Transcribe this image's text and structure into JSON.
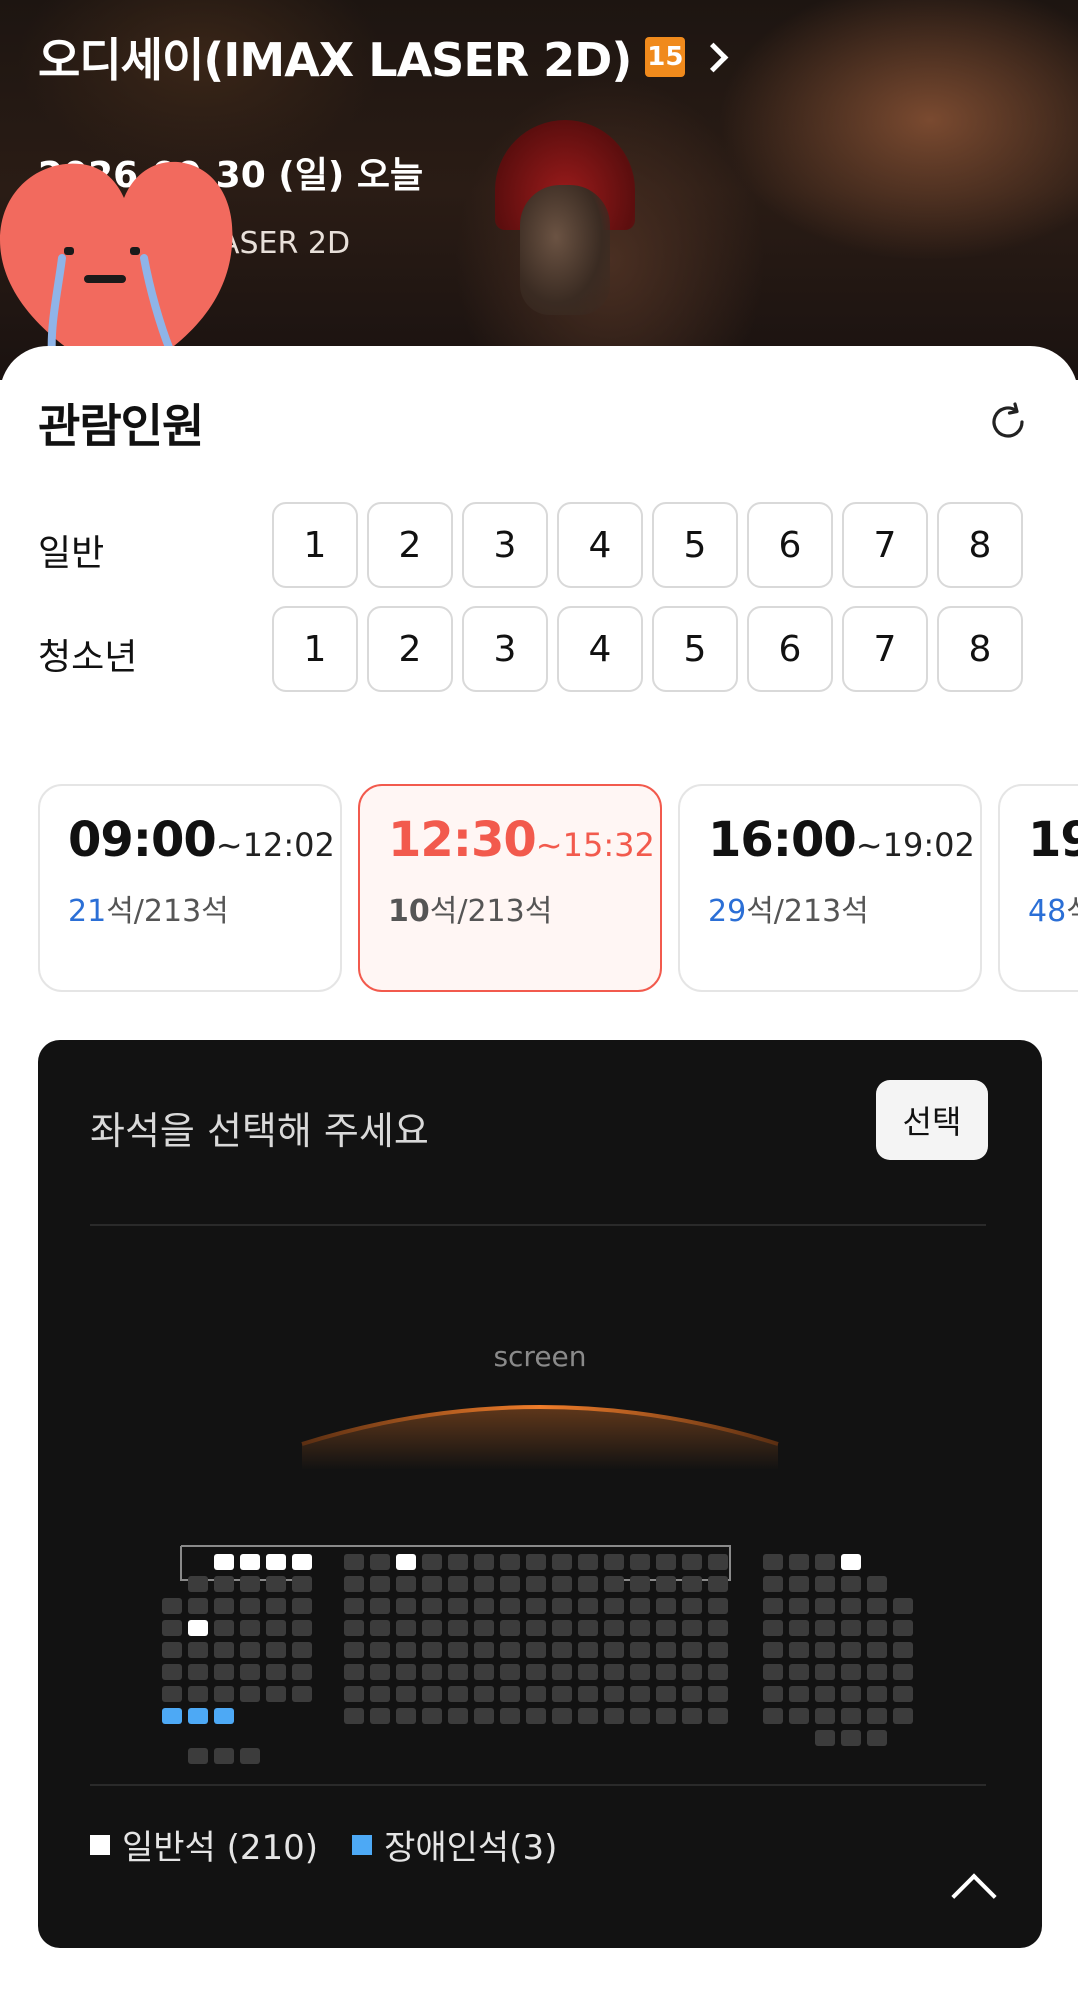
{
  "movie": {
    "title": "오디세이(IMAX LASER 2D)",
    "rating": "15",
    "date": "2026.09.30 (일) 오늘",
    "hall": "AX관 IMAX LASER 2D"
  },
  "audience": {
    "title": "관람인원",
    "rows": [
      {
        "label": "일반",
        "numbers": [
          "1",
          "2",
          "3",
          "4",
          "5",
          "6",
          "7",
          "8"
        ]
      },
      {
        "label": "청소년",
        "numbers": [
          "1",
          "2",
          "3",
          "4",
          "5",
          "6",
          "7",
          "8"
        ]
      }
    ]
  },
  "showtimes": [
    {
      "start": "09:00",
      "end": "~12:02",
      "available": "21",
      "total": "석/213석",
      "selected": false
    },
    {
      "start": "12:30",
      "end": "~15:32",
      "available": "10",
      "total": "석/213석",
      "selected": true
    },
    {
      "start": "16:00",
      "end": "~19:02",
      "available": "29",
      "total": "석/213석",
      "selected": false
    },
    {
      "start": "19",
      "end": "",
      "available": "48",
      "total": "석",
      "selected": false
    }
  ],
  "seatmap": {
    "prompt": "좌석을 선택해 주세요",
    "select_button": "선택",
    "screen_label": "screen",
    "legend": [
      {
        "label": "일반석 (210)",
        "color": "#ffffff"
      },
      {
        "label": "장애인석(3)",
        "color": "#4da9f5"
      }
    ]
  },
  "colors": {
    "accent": "#f25a4d",
    "available": "#2b6fd6",
    "seat_taken": "#3c3c3c",
    "seat_open": "#ffffff",
    "seat_accessible": "#4da9f5"
  }
}
